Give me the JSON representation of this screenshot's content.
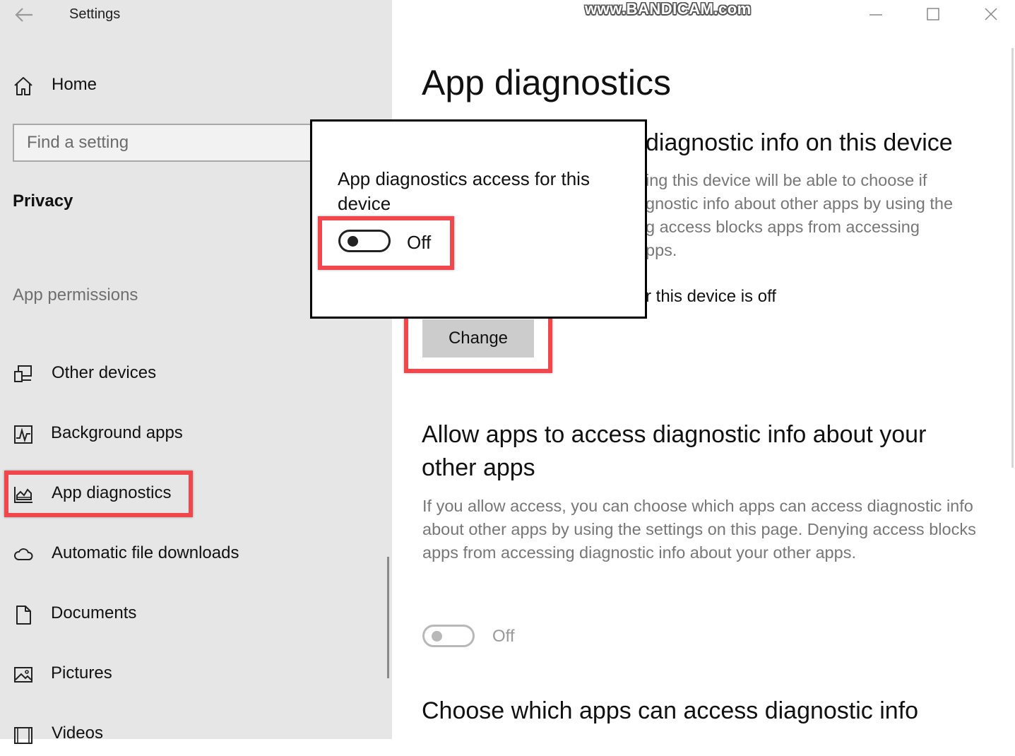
{
  "window": {
    "title": "Settings",
    "watermark": "www.BANDICAM.com"
  },
  "sidebar": {
    "home_label": "Home",
    "search_placeholder": "Find a setting",
    "section_title": "Privacy",
    "subsection_label": "App permissions",
    "items": [
      {
        "label": "Other devices",
        "icon": "other-devices-icon"
      },
      {
        "label": "Background apps",
        "icon": "background-apps-icon"
      },
      {
        "label": "App diagnostics",
        "icon": "app-diagnostics-icon",
        "selected": true
      },
      {
        "label": "Automatic file downloads",
        "icon": "cloud-icon"
      },
      {
        "label": "Documents",
        "icon": "document-icon"
      },
      {
        "label": "Pictures",
        "icon": "pictures-icon"
      },
      {
        "label": "Videos",
        "icon": "videos-icon"
      }
    ]
  },
  "main": {
    "page_title": "App diagnostics",
    "section1": {
      "title_partial": "diagnostic info on this device",
      "desc_lines": [
        "ing this device will be able to choose if",
        "gnostic info about other apps by using the",
        "g access blocks apps from accessing",
        "pps."
      ],
      "status_partial": "r this device is off",
      "change_button": "Change"
    },
    "section2": {
      "title": "Allow apps to access diagnostic info about your other apps",
      "description": "If you allow access, you can choose which apps can access diagnostic info about other apps by using the settings on this page. Denying access blocks apps from accessing diagnostic info about your other apps.",
      "toggle_label": "Off",
      "toggle_on": false,
      "toggle_enabled": false
    },
    "section3": {
      "title": "Choose which apps can access diagnostic info"
    }
  },
  "popup": {
    "title": "App diagnostics access for this device",
    "toggle_label": "Off",
    "toggle_on": false
  },
  "colors": {
    "sidebar_bg": "#e6e6e6",
    "highlight": "#f0474d",
    "button_bg": "#cccccc",
    "secondary_text": "#777777"
  }
}
